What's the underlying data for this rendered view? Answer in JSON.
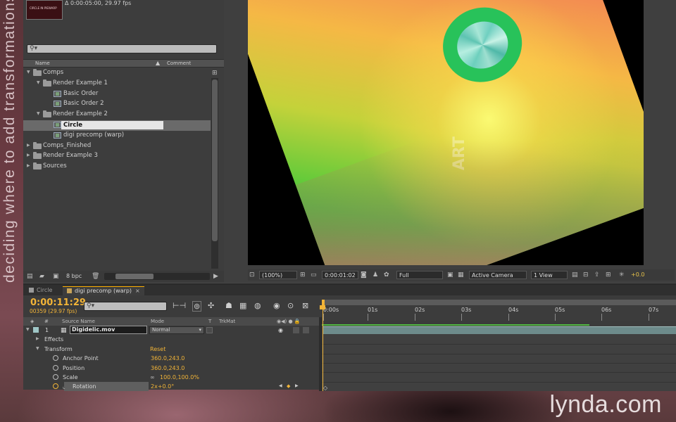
{
  "caption": "deciding where to add transformations",
  "watermark": "lynda.com",
  "project": {
    "thumb_label": "CIRCLE IN PIEWARP",
    "info": "Δ 0:00:05:00, 29.97 fps",
    "search_placeholder": "",
    "columns": {
      "name": "Name",
      "comment": "Comment"
    },
    "tree": [
      {
        "label": "Comps",
        "type": "folder",
        "depth": 0,
        "open": true
      },
      {
        "label": "Render Example 1",
        "type": "folder",
        "depth": 1,
        "open": true
      },
      {
        "label": "Basic Order",
        "type": "comp",
        "depth": 2
      },
      {
        "label": "Basic Order 2",
        "type": "comp",
        "depth": 2
      },
      {
        "label": "Render Example 2",
        "type": "folder",
        "depth": 1,
        "open": true
      },
      {
        "label": "Circle",
        "type": "comp",
        "depth": 2,
        "selected": true
      },
      {
        "label": "digi precomp (warp)",
        "type": "comp",
        "depth": 2
      },
      {
        "label": "Comps_Finished",
        "type": "folder",
        "depth": 0,
        "open": false
      },
      {
        "label": "Render Example 3",
        "type": "folder",
        "depth": 0,
        "open": false
      },
      {
        "label": "Sources",
        "type": "folder",
        "depth": 0,
        "open": false
      }
    ],
    "footer": {
      "bpc": "8 bpc"
    }
  },
  "viewer": {
    "zoom": "(100%)",
    "timecode": "0:00:01:02",
    "resolution": "Full",
    "camera": "Active Camera",
    "views": "1 View",
    "exposure": "+0.0",
    "art_logo": "ART"
  },
  "timeline": {
    "tabs": [
      {
        "label": "Circle",
        "active": false,
        "swatch": "#9a9a9a"
      },
      {
        "label": "digi precomp (warp)",
        "active": true,
        "swatch": "#c9a45a"
      }
    ],
    "close_glyph": "×",
    "timecode": "0:00:11:29",
    "frames": "00359 (29.97 fps)",
    "ruler": [
      "0:00s",
      "01s",
      "02s",
      "03s",
      "04s",
      "05s",
      "06s",
      "07s"
    ],
    "headers": {
      "num": "#",
      "source": "Source Name",
      "mode": "Mode",
      "t": "T",
      "trkmat": "TrkMat"
    },
    "layer": {
      "index": "1",
      "name": "Digidelic.mov",
      "mode": "Normal"
    },
    "props": {
      "effects": "Effects",
      "transform": "Transform",
      "reset": "Reset",
      "anchor_label": "Anchor Point",
      "anchor_value": "360.0,243.0",
      "position_label": "Position",
      "position_value": "360.0,243.0",
      "scale_label": "Scale",
      "scale_value": "100.0,100.0%",
      "rotation_label": "Rotation",
      "rotation_value": "2x+0.0°"
    }
  }
}
